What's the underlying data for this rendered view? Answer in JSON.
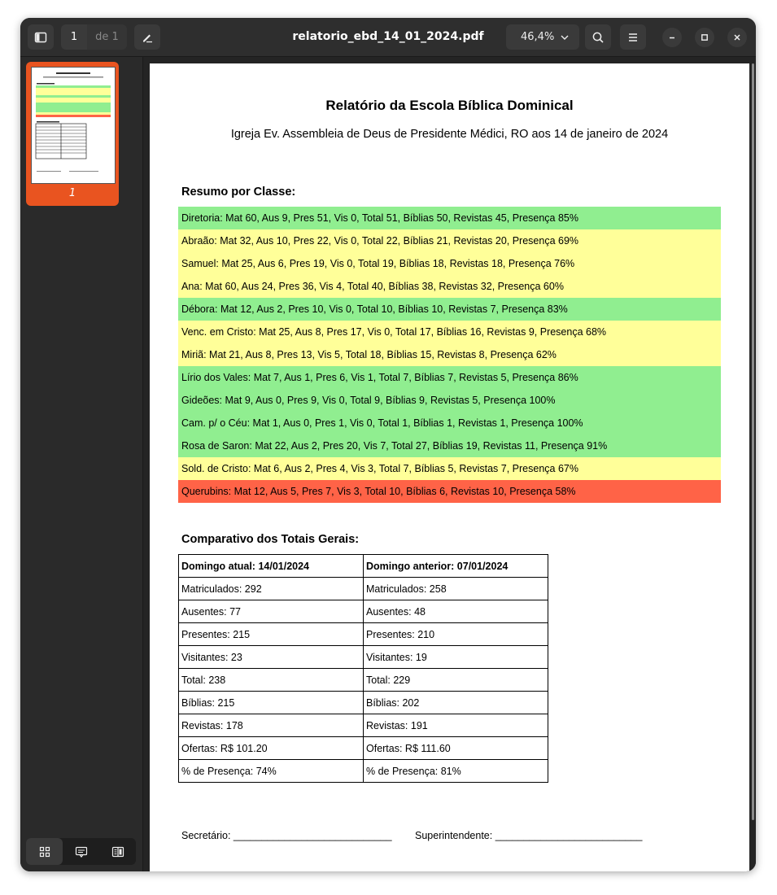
{
  "window": {
    "title": "relatorio_ebd_14_01_2024.pdf",
    "page_current": "1",
    "page_total_label": "de 1",
    "zoom": "46,4%"
  },
  "sidebar": {
    "thumbnail_label": "1"
  },
  "colors": {
    "accent": "#e95420",
    "green": "#90ee90",
    "yellow": "#ffff99",
    "red": "#ff6347"
  },
  "icons": [
    "sidebar-toggle-icon",
    "annotate-pen-icon",
    "chevron-down-icon",
    "search-icon",
    "hamburger-menu-icon",
    "minimize-icon",
    "maximize-icon",
    "close-icon",
    "thumbnails-grid-icon",
    "annotations-icon",
    "outline-book-icon"
  ],
  "report": {
    "title": "Relatório da Escola Bíblica Dominical",
    "subtitle": "Igreja Ev. Assembleia de Deus de Presidente Médici, RO aos 14 de janeiro de 2024",
    "summary_heading": "Resumo por Classe:",
    "classes": [
      {
        "text": "Diretoria: Mat 60, Aus 9, Pres 51, Vis 0, Total 51, Bíblias 50, Revistas 45, Presença 85%",
        "status": "green"
      },
      {
        "text": "Abraão: Mat 32, Aus 10, Pres 22, Vis 0, Total 22, Bíblias 21, Revistas 20, Presença 69%",
        "status": "yellow"
      },
      {
        "text": "Samuel: Mat 25, Aus 6, Pres 19, Vis 0, Total 19, Bíblias 18, Revistas 18, Presença 76%",
        "status": "yellow"
      },
      {
        "text": "Ana: Mat 60, Aus 24, Pres 36, Vis 4, Total 40, Bíblias 38, Revistas 32, Presença 60%",
        "status": "yellow"
      },
      {
        "text": "Débora: Mat 12, Aus 2, Pres 10, Vis 0, Total 10, Bíblias 10, Revistas 7, Presença 83%",
        "status": "green"
      },
      {
        "text": "Venc. em Cristo: Mat 25, Aus 8, Pres 17, Vis 0, Total 17, Bíblias 16, Revistas 9, Presença 68%",
        "status": "yellow"
      },
      {
        "text": "Miriã: Mat 21, Aus 8, Pres 13, Vis 5, Total 18, Bíblias 15, Revistas 8, Presença 62%",
        "status": "yellow"
      },
      {
        "text": "Lírio dos Vales: Mat 7, Aus 1, Pres 6, Vis 1, Total 7, Bíblias 7, Revistas 5, Presença 86%",
        "status": "green"
      },
      {
        "text": "Gideões: Mat 9, Aus 0, Pres 9, Vis 0, Total 9, Bíblias 9, Revistas 5, Presença 100%",
        "status": "green"
      },
      {
        "text": "Cam. p/ o Céu: Mat 1, Aus 0, Pres 1, Vis 0, Total 1, Bíblias 1, Revistas 1, Presença 100%",
        "status": "green"
      },
      {
        "text": "Rosa de Saron: Mat 22, Aus 2, Pres 20, Vis 7, Total 27, Bíblias 19, Revistas 11, Presença 91%",
        "status": "green"
      },
      {
        "text": "Sold. de Cristo: Mat 6, Aus 2, Pres 4, Vis 3, Total 7, Bíblias 5, Revistas 7, Presença 67%",
        "status": "yellow"
      },
      {
        "text": "Querubins: Mat 12, Aus 5, Pres 7, Vis 3, Total 10, Bíblias 6, Revistas 10, Presença 58%",
        "status": "red"
      }
    ],
    "compare_heading": "Comparativo dos Totais Gerais:",
    "compare_headers": [
      "Domingo atual: 14/01/2024",
      "Domingo anterior: 07/01/2024"
    ],
    "compare_rows": [
      [
        "Matriculados: 292",
        "Matriculados: 258"
      ],
      [
        "Ausentes: 77",
        "Ausentes: 48"
      ],
      [
        "Presentes: 215",
        "Presentes: 210"
      ],
      [
        "Visitantes: 23",
        "Visitantes: 19"
      ],
      [
        "Total: 238",
        "Total: 229"
      ],
      [
        "Bíblias: 215",
        "Bíblias: 202"
      ],
      [
        "Revistas: 178",
        "Revistas: 191"
      ],
      [
        "Ofertas: R$ 101.20",
        "Ofertas: R$ 111.60"
      ],
      [
        "% de Presença: 74%",
        "% de Presença: 81%"
      ]
    ],
    "secretary": "Secretário: ____________________________",
    "superintendent": "Superintendente: __________________________"
  }
}
